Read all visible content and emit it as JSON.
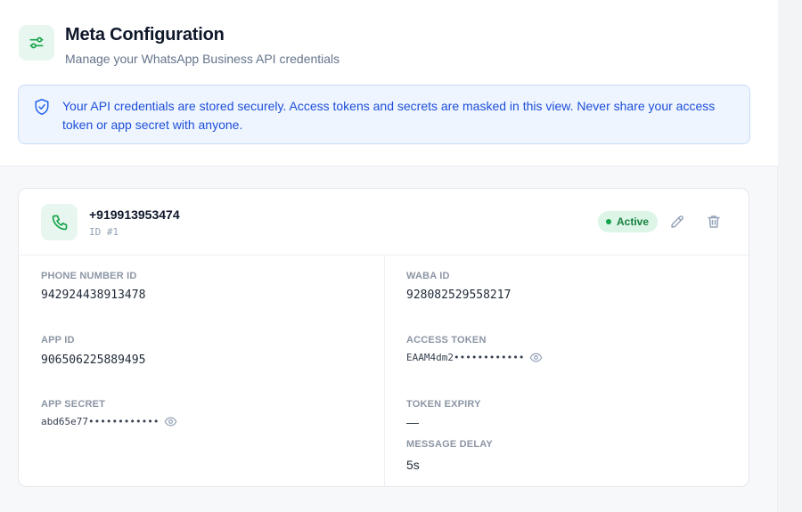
{
  "header": {
    "title": "Meta Configuration",
    "subtitle": "Manage your WhatsApp Business API credentials"
  },
  "notice": {
    "text": "Your API credentials are stored securely. Access tokens and secrets are masked in this view. Never share your access token or app secret with anyone."
  },
  "card": {
    "phone_number": "+919913953474",
    "record_id": "ID #1",
    "status": "Active",
    "fields": {
      "phone_number_id": {
        "label": "PHONE NUMBER ID",
        "value": "942924438913478"
      },
      "waba_id": {
        "label": "WABA ID",
        "value": "928082529558217"
      },
      "app_id": {
        "label": "APP ID",
        "value": "906506225889495"
      },
      "access_token": {
        "label": "ACCESS TOKEN",
        "value": "EAAM4dm2••••••••••••"
      },
      "app_secret": {
        "label": "APP SECRET",
        "value": "abd65e77••••••••••••"
      },
      "token_expiry": {
        "label": "TOKEN EXPIRY",
        "value": "—"
      },
      "message_delay": {
        "label": "MESSAGE DELAY",
        "value": "5s"
      }
    }
  },
  "icons": {
    "header": "sliders-icon",
    "notice": "shield-check-icon",
    "phone": "phone-icon",
    "edit": "pencil-icon",
    "delete": "trash-icon",
    "reveal": "eye-icon"
  },
  "colors": {
    "accent": "#16a34a",
    "notice_text": "#1d4ed8",
    "notice_bg": "#eef5ff"
  }
}
